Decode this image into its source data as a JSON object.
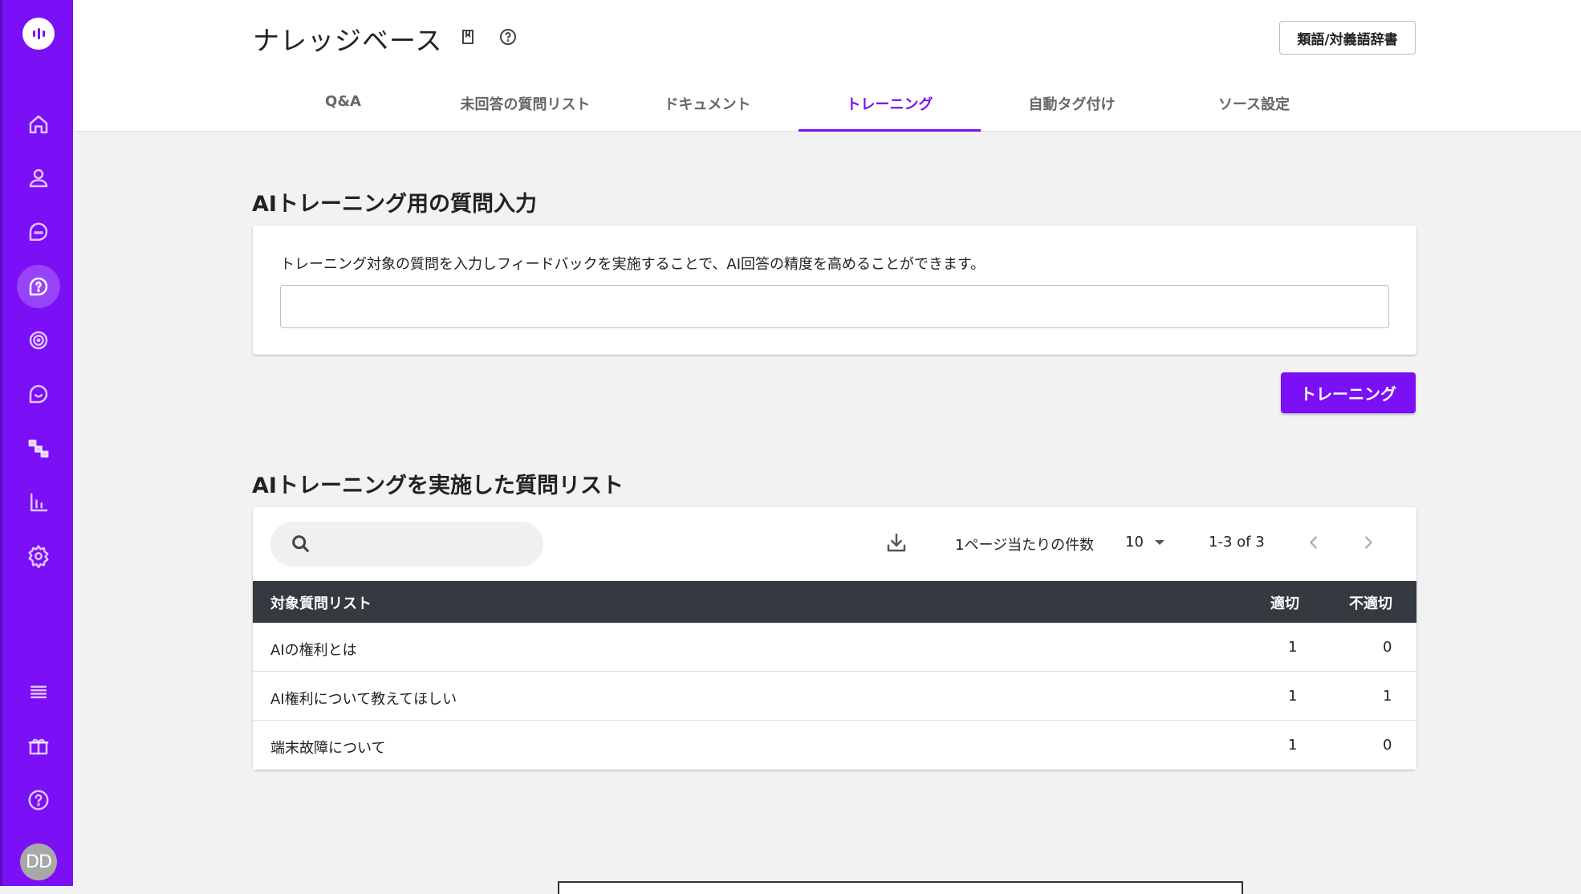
{
  "sidebar": {
    "items": [
      {
        "name": "home-icon"
      },
      {
        "name": "user-icon"
      },
      {
        "name": "chat-icon"
      },
      {
        "name": "knowledge-icon",
        "active": true
      },
      {
        "name": "target-icon"
      },
      {
        "name": "message-icon"
      },
      {
        "name": "flow-icon"
      },
      {
        "name": "analytics-icon"
      },
      {
        "name": "gear-icon"
      },
      {
        "name": "menu-icon"
      },
      {
        "name": "gift-icon"
      },
      {
        "name": "help-icon"
      }
    ],
    "avatar_initials": "DD",
    "accent": "#7b0ff5"
  },
  "header": {
    "title": "ナレッジベース",
    "dict_button": "類語/対義語辞書",
    "tabs": [
      {
        "label": "Q&A"
      },
      {
        "label": "未回答の質問リスト"
      },
      {
        "label": "ドキュメント"
      },
      {
        "label": "トレーニング",
        "active": true
      },
      {
        "label": "自動タグ付け"
      },
      {
        "label": "ソース設定"
      }
    ]
  },
  "training_input": {
    "section_title": "AIトレーニング用の質問入力",
    "description": "トレーニング対象の質問を入力しフィードバックを実施することで、AI回答の精度を高めることができます。",
    "input_value": "",
    "button_label": "トレーニング"
  },
  "trained_list": {
    "section_title": "AIトレーニングを実施した質問リスト",
    "search_placeholder": "",
    "per_page_label": "1ページ当たりの件数",
    "per_page_value": "10",
    "range_text": "1-3 of 3",
    "columns": {
      "question": "対象質問リスト",
      "appropriate": "適切",
      "inappropriate": "不適切"
    },
    "rows": [
      {
        "question": "AIの権利とは",
        "appropriate": "1",
        "inappropriate": "0"
      },
      {
        "question": "AI権利について教えてほしい",
        "appropriate": "1",
        "inappropriate": "1"
      },
      {
        "question": "端末故障について",
        "appropriate": "1",
        "inappropriate": "0"
      }
    ]
  }
}
